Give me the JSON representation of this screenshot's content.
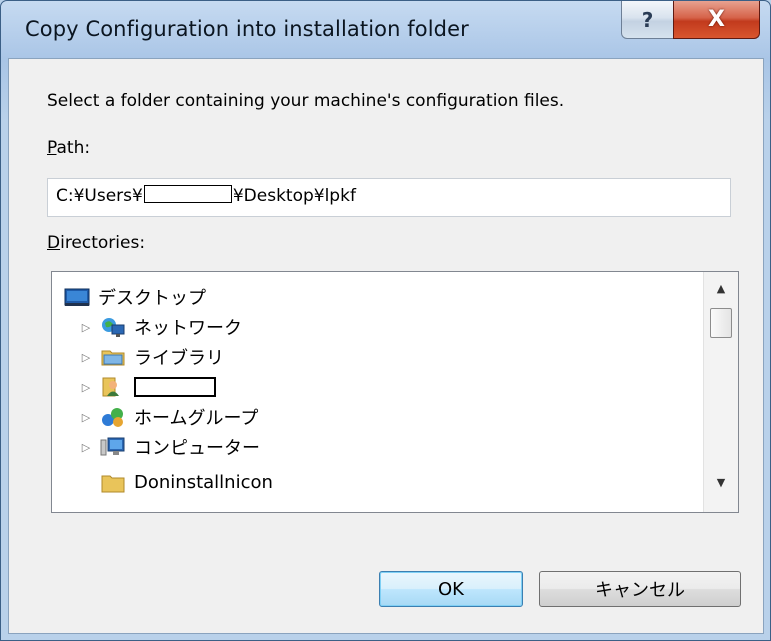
{
  "window": {
    "title": "Copy Configuration into installation folder",
    "help_glyph": "?",
    "close_glyph": "X"
  },
  "dialog": {
    "instruction": "Select a folder containing your machine's configuration files.",
    "path_label_accel": "P",
    "path_label_rest": "ath:",
    "path_value_prefix": "C:¥Users¥",
    "path_value_suffix": "¥Desktop¥lpkf",
    "directories_label_accel": "D",
    "directories_label_rest": "irectories:"
  },
  "tree": {
    "items": [
      {
        "label": "デスクトップ",
        "icon": "desktop-icon",
        "indent": 0
      },
      {
        "label": "ネットワーク",
        "icon": "network-icon",
        "indent": 1
      },
      {
        "label": "ライブラリ",
        "icon": "library-icon",
        "indent": 1
      },
      {
        "label": "",
        "icon": "user-folder-icon",
        "indent": 1,
        "redacted": true
      },
      {
        "label": "ホームグループ",
        "icon": "homegroup-icon",
        "indent": 1
      },
      {
        "label": "コンピューター",
        "icon": "computer-icon",
        "indent": 1
      },
      {
        "label": "Doninstallnicon",
        "icon": "folder-icon",
        "indent": 1,
        "partial": true
      }
    ],
    "expander_glyph": "▷"
  },
  "buttons": {
    "ok": "OK",
    "cancel": "キャンセル"
  },
  "colors": {
    "title_bar": "#b9d1ea",
    "close_button": "#c94a2f",
    "ok_button_border": "#3c7fb1"
  }
}
